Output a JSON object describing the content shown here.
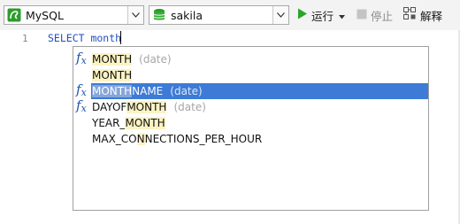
{
  "toolbar": {
    "connection": {
      "label": "MySQL",
      "icon": "mysql-dolphin-icon",
      "icon_color": "#2e9b2e"
    },
    "database": {
      "label": "sakila",
      "icon": "database-icon",
      "icon_color": "#2e9b2e"
    },
    "run": {
      "label": "运行",
      "icon": "play-icon",
      "color": "#2aa52a"
    },
    "stop": {
      "label": "停止",
      "icon": "stop-icon",
      "enabled": false
    },
    "explain": {
      "label": "解释",
      "icon": "explain-icon"
    }
  },
  "editor": {
    "line_number": "1",
    "code": "SELECT month"
  },
  "autocomplete": {
    "items": [
      {
        "pre": "",
        "match": "MONTH",
        "post": "",
        "meta": "(date)",
        "function": true,
        "selected": false
      },
      {
        "pre": "",
        "match": "MONTH",
        "post": "",
        "meta": "",
        "function": false,
        "selected": false
      },
      {
        "pre": "",
        "match": "MONTH",
        "post": "NAME",
        "meta": "(date)",
        "function": true,
        "selected": true
      },
      {
        "pre": "DAYOF",
        "match": "MONTH",
        "post": "",
        "meta": "(date)",
        "function": true,
        "selected": false
      },
      {
        "pre": "YEAR_",
        "match": "MONTH",
        "post": "",
        "meta": "",
        "function": false,
        "selected": false
      },
      {
        "pre": "MAX_CO",
        "match": "N",
        "post": "NECTIONS_PER_HOUR",
        "meta": "",
        "function": false,
        "selected": false
      }
    ],
    "selection_color": "#3d7bd6",
    "match_highlight_color": "#fbf3c3"
  }
}
